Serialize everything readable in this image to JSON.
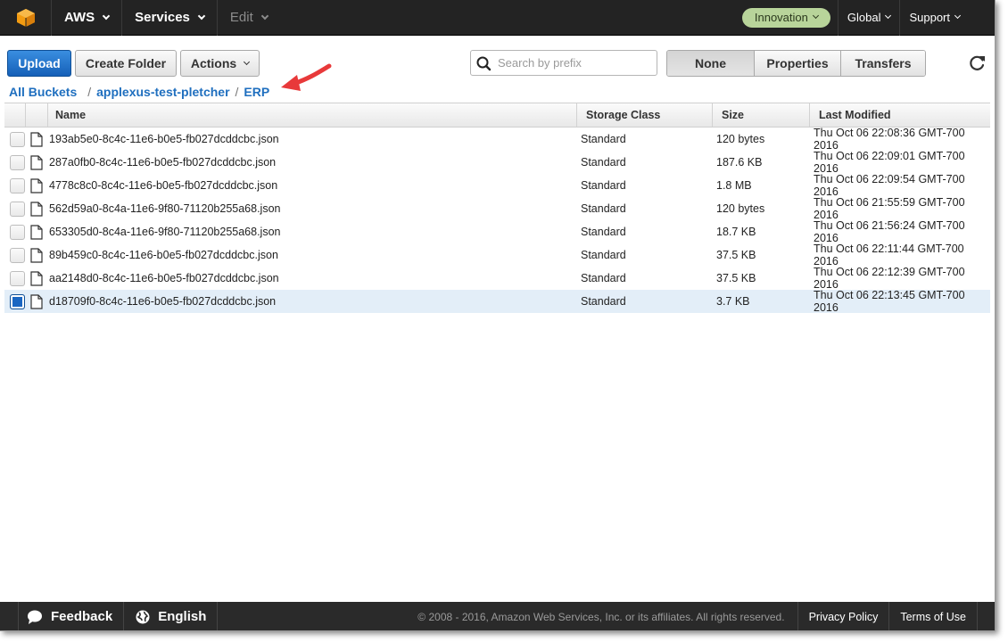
{
  "nav": {
    "logo_icon": "aws-cube-icon",
    "aws_label": "AWS",
    "services_label": "Services",
    "edit_label": "Edit",
    "account_label": "Innovation",
    "region_label": "Global",
    "support_label": "Support"
  },
  "toolbar": {
    "upload_label": "Upload",
    "create_folder_label": "Create Folder",
    "actions_label": "Actions",
    "search_placeholder": "Search by prefix",
    "view_tabs": [
      "None",
      "Properties",
      "Transfers"
    ],
    "refresh_icon": "refresh-icon"
  },
  "breadcrumb": {
    "all_buckets": "All Buckets",
    "bucket": "applexus-test-pletcher",
    "folder": "ERP",
    "separator": "/"
  },
  "table": {
    "columns": [
      "Name",
      "Storage Class",
      "Size",
      "Last Modified"
    ],
    "rows": [
      {
        "name": "193ab5e0-8c4c-11e6-b0e5-fb027dcddcbc.json",
        "storage_class": "Standard",
        "size": "120 bytes",
        "last_modified": "Thu Oct 06 22:08:36 GMT-700 2016"
      },
      {
        "name": "287a0fb0-8c4c-11e6-b0e5-fb027dcddcbc.json",
        "storage_class": "Standard",
        "size": "187.6 KB",
        "last_modified": "Thu Oct 06 22:09:01 GMT-700 2016"
      },
      {
        "name": "4778c8c0-8c4c-11e6-b0e5-fb027dcddcbc.json",
        "storage_class": "Standard",
        "size": "1.8 MB",
        "last_modified": "Thu Oct 06 22:09:54 GMT-700 2016"
      },
      {
        "name": "562d59a0-8c4a-11e6-9f80-71120b255a68.json",
        "storage_class": "Standard",
        "size": "120 bytes",
        "last_modified": "Thu Oct 06 21:55:59 GMT-700 2016"
      },
      {
        "name": "653305d0-8c4a-11e6-9f80-71120b255a68.json",
        "storage_class": "Standard",
        "size": "18.7 KB",
        "last_modified": "Thu Oct 06 21:56:24 GMT-700 2016"
      },
      {
        "name": "89b459c0-8c4c-11e6-b0e5-fb027dcddcbc.json",
        "storage_class": "Standard",
        "size": "37.5 KB",
        "last_modified": "Thu Oct 06 22:11:44 GMT-700 2016"
      },
      {
        "name": "aa2148d0-8c4c-11e6-b0e5-fb027dcddcbc.json",
        "storage_class": "Standard",
        "size": "37.5 KB",
        "last_modified": "Thu Oct 06 22:12:39 GMT-700 2016"
      },
      {
        "name": "d18709f0-8c4c-11e6-b0e5-fb027dcddcbc.json",
        "storage_class": "Standard",
        "size": "3.7 KB",
        "last_modified": "Thu Oct 06 22:13:45 GMT-700 2016",
        "selected": true
      }
    ]
  },
  "footer": {
    "feedback_label": "Feedback",
    "language_label": "English",
    "copyright": "© 2008 - 2016, Amazon Web Services, Inc. or its affiliates. All rights reserved.",
    "privacy_label": "Privacy Policy",
    "terms_label": "Terms of Use"
  },
  "colors": {
    "primary_button": "#1f6fc9",
    "link": "#1f6fbf",
    "nav_bg": "#232323",
    "account_pill": "#b8d49a",
    "selected_row": "#e3eef8",
    "annotation_arrow": "#e8393a"
  }
}
